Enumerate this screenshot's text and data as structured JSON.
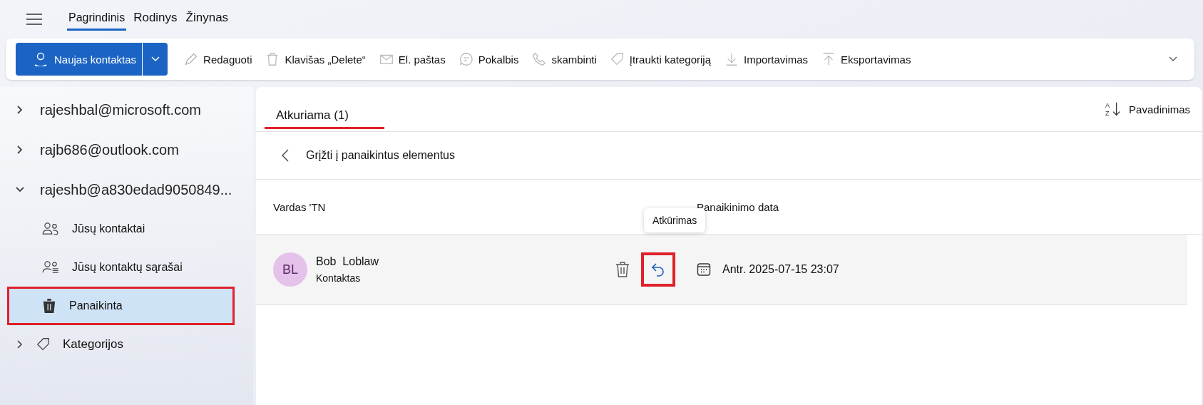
{
  "menu_tabs": [
    {
      "label": "Pagrindinis",
      "selected": true
    },
    {
      "label": "Rodinys",
      "selected": false
    },
    {
      "label": "Žinynas",
      "selected": false
    }
  ],
  "ribbon": {
    "new_button": "Naujas kontaktas",
    "items": [
      {
        "kind": "pencil",
        "label": "Redaguoti"
      },
      {
        "kind": "trash",
        "label": "Klavišas „Delete“"
      },
      {
        "kind": "mail",
        "label": "El. paštas"
      },
      {
        "kind": "chat",
        "label": "Pokalbis"
      },
      {
        "kind": "phone",
        "label": "skambinti"
      },
      {
        "kind": "tag",
        "label": "Įtraukti kategoriją"
      },
      {
        "kind": "download",
        "label": "Importavimas"
      },
      {
        "kind": "upload",
        "label": "Eksportavimas"
      }
    ]
  },
  "sidebar": {
    "items": [
      {
        "label": "rajeshbal@microsoft.com",
        "expanded": false
      },
      {
        "label": "rajb686@outlook.com",
        "expanded": false
      },
      {
        "label": "rajeshb@a830edad9050849...",
        "expanded": true,
        "children": [
          {
            "kind": "contacts",
            "label": "Jūsų kontaktai",
            "selected": false,
            "highlighted": false
          },
          {
            "kind": "lists",
            "label": "Jūsų kontaktų sąrašai",
            "selected": false,
            "highlighted": false
          },
          {
            "kind": "trash",
            "label": "Panaikinta",
            "selected": true,
            "highlighted": true
          }
        ]
      }
    ],
    "categories": {
      "label": "Kategorijos",
      "expanded": false
    }
  },
  "main": {
    "tab": "Atkuriama (1)",
    "tab_highlighted": true,
    "sort": "Pavadinimas",
    "sort_icon_letters": [
      "A",
      "Z"
    ],
    "back": "Grįžti į panaikintus elementus",
    "columns": [
      "Vardas 'TN",
      "Panaikinimo data"
    ],
    "rows": [
      {
        "initials": "BL",
        "first_name": "Bob",
        "last_name": "Loblaw",
        "type": "Kontaktas",
        "tooltip": "Atkūrimas",
        "restore_highlighted": true,
        "date": "Antr. 2025-07-15 23:07"
      }
    ]
  }
}
